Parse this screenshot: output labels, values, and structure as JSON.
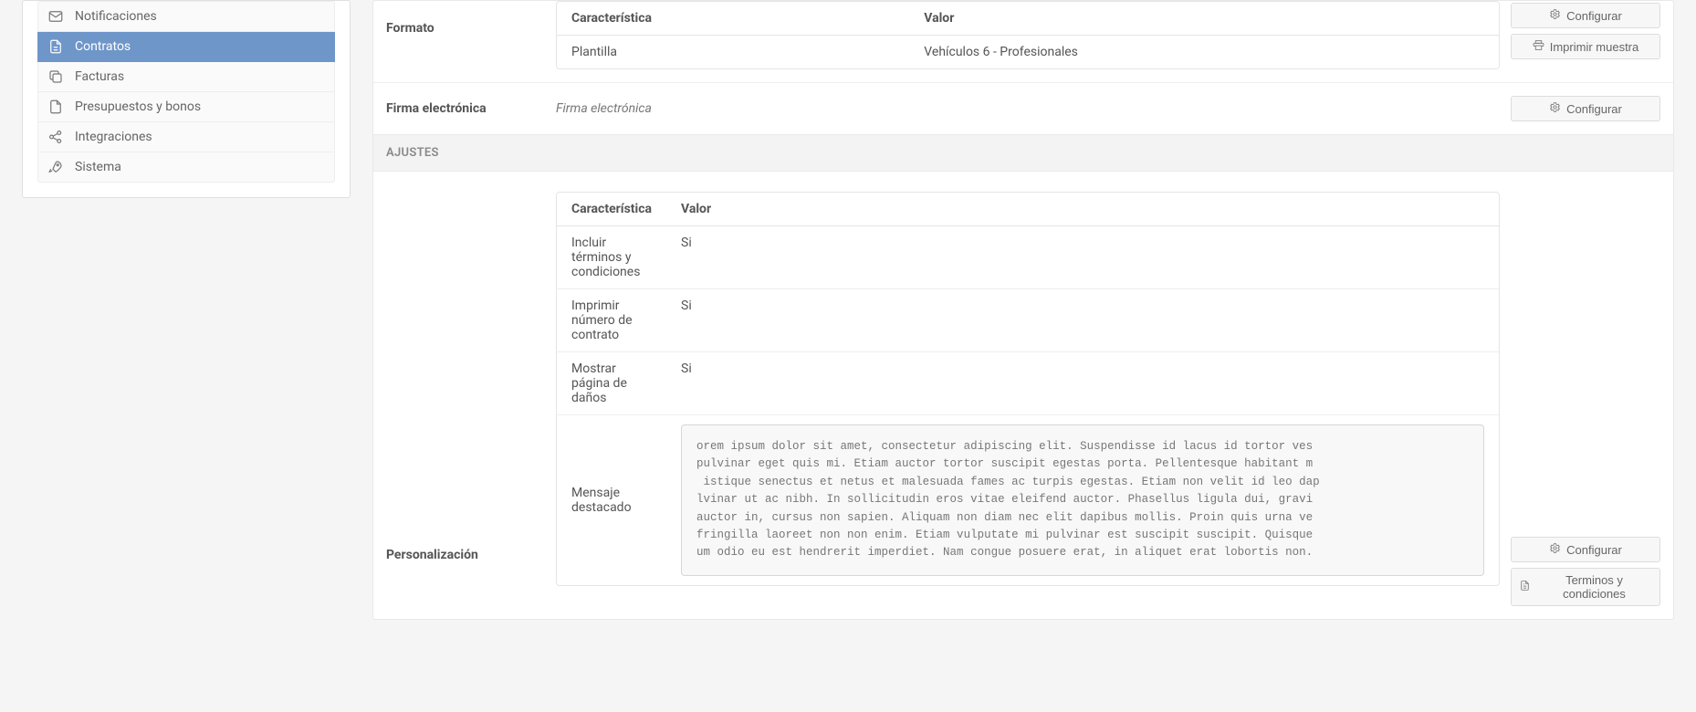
{
  "sidebar": {
    "items": [
      {
        "label": "Notificaciones",
        "icon": "mail-icon",
        "active": false
      },
      {
        "label": "Contratos",
        "icon": "document-icon",
        "active": true
      },
      {
        "label": "Facturas",
        "icon": "copy-icon",
        "active": false
      },
      {
        "label": "Presupuestos y bonos",
        "icon": "file-icon",
        "active": false
      },
      {
        "label": "Integraciones",
        "icon": "share-icon",
        "active": false
      },
      {
        "label": "Sistema",
        "icon": "rocket-icon",
        "active": false
      }
    ]
  },
  "formato": {
    "label": "Formato",
    "table": {
      "headers": {
        "caracteristica": "Característica",
        "valor": "Valor"
      },
      "rows": [
        {
          "caracteristica": "Plantilla",
          "valor": "Vehículos 6 - Profesionales"
        }
      ]
    },
    "actions": {
      "configurar": "Configurar",
      "imprimir": "Imprimir muestra"
    }
  },
  "firma": {
    "label": "Firma electrónica",
    "value": "Firma electrónica",
    "actions": {
      "configurar": "Configurar"
    }
  },
  "ajustes": {
    "header": "AJUSTES"
  },
  "personalizacion": {
    "label": "Personalización",
    "table": {
      "headers": {
        "caracteristica": "Característica",
        "valor": "Valor"
      },
      "rows": [
        {
          "caracteristica": "Incluir términos y condiciones",
          "valor": "Si"
        },
        {
          "caracteristica": "Imprimir número de contrato",
          "valor": "Si"
        },
        {
          "caracteristica": "Mostrar página de daños",
          "valor": "Si"
        }
      ],
      "mensaje": {
        "label": "Mensaje destacado",
        "text": "orem ipsum dolor sit amet, consectetur adipiscing elit. Suspendisse id lacus id tortor ves\npulvinar eget quis mi. Etiam auctor tortor suscipit egestas porta. Pellentesque habitant m\n istique senectus et netus et malesuada fames ac turpis egestas. Etiam non velit id leo dap\nlvinar ut ac nibh. In sollicitudin eros vitae eleifend auctor. Phasellus ligula dui, gravi\nauctor in, cursus non sapien. Aliquam non diam nec elit dapibus mollis. Proin quis urna ve\nfringilla laoreet non non enim. Etiam vulputate mi pulvinar est suscipit suscipit. Quisque\num odio eu est hendrerit imperdiet. Nam congue posuere erat, in aliquet erat lobortis non."
      }
    },
    "actions": {
      "configurar": "Configurar",
      "terminos": "Terminos y condiciones"
    }
  }
}
